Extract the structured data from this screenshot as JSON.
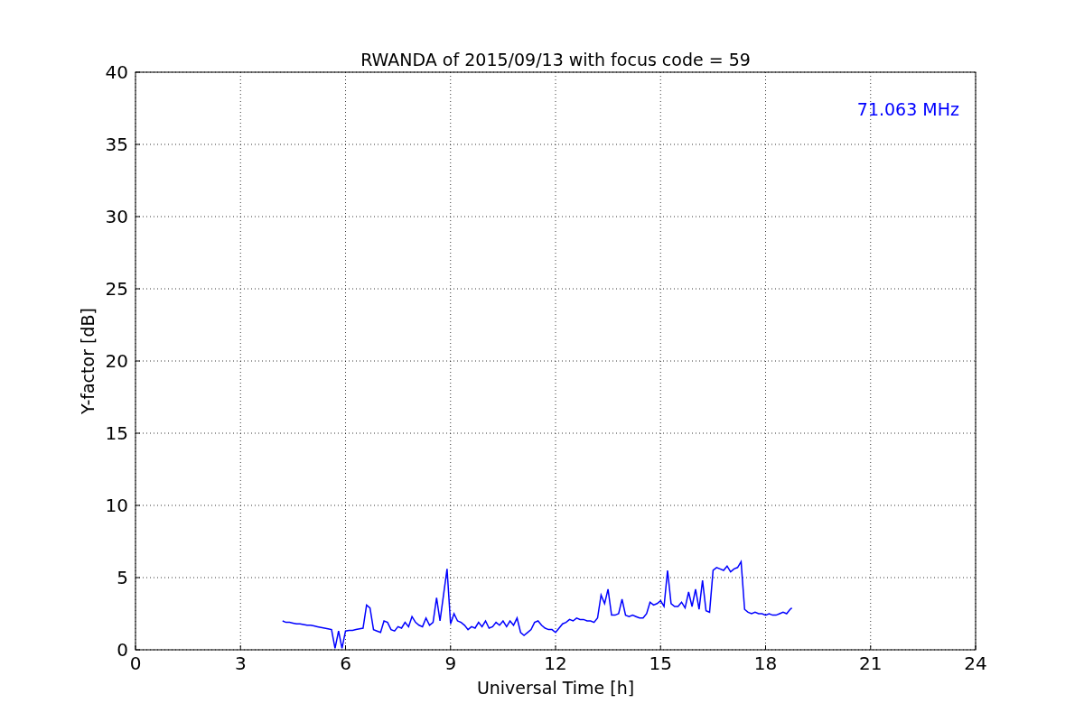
{
  "chart_data": {
    "type": "line",
    "title": "RWANDA of 2015/09/13 with focus code = 59",
    "xlabel": "Universal Time [h]",
    "ylabel": "Y-factor [dB]",
    "xlim": [
      0,
      24
    ],
    "ylim": [
      0,
      40
    ],
    "xticks": [
      0,
      3,
      6,
      9,
      12,
      15,
      18,
      21,
      24
    ],
    "yticks": [
      0,
      5,
      10,
      15,
      20,
      25,
      30,
      35,
      40
    ],
    "grid": true,
    "x": [
      4.2,
      4.3,
      4.4,
      4.5,
      4.6,
      4.7,
      4.8,
      4.9,
      5.0,
      5.1,
      5.2,
      5.3,
      5.4,
      5.5,
      5.6,
      5.7,
      5.8,
      5.9,
      6.0,
      6.1,
      6.2,
      6.3,
      6.4,
      6.5,
      6.6,
      6.7,
      6.8,
      6.9,
      7.0,
      7.1,
      7.2,
      7.3,
      7.4,
      7.5,
      7.6,
      7.7,
      7.8,
      7.9,
      8.0,
      8.1,
      8.2,
      8.3,
      8.4,
      8.5,
      8.6,
      8.7,
      8.8,
      8.9,
      9.0,
      9.1,
      9.2,
      9.3,
      9.4,
      9.5,
      9.6,
      9.7,
      9.8,
      9.9,
      10.0,
      10.1,
      10.2,
      10.3,
      10.4,
      10.5,
      10.6,
      10.7,
      10.8,
      10.9,
      11.0,
      11.1,
      11.2,
      11.3,
      11.4,
      11.5,
      11.6,
      11.7,
      11.8,
      11.9,
      12.0,
      12.1,
      12.2,
      12.3,
      12.4,
      12.5,
      12.6,
      12.7,
      12.8,
      12.9,
      13.0,
      13.1,
      13.2,
      13.3,
      13.4,
      13.5,
      13.6,
      13.7,
      13.8,
      13.9,
      14.0,
      14.1,
      14.2,
      14.3,
      14.4,
      14.5,
      14.6,
      14.7,
      14.8,
      14.9,
      15.0,
      15.1,
      15.2,
      15.3,
      15.4,
      15.5,
      15.6,
      15.7,
      15.8,
      15.9,
      16.0,
      16.1,
      16.2,
      16.3,
      16.4,
      16.5,
      16.6,
      16.7,
      16.8,
      16.9,
      17.0,
      17.1,
      17.2,
      17.3,
      17.4,
      17.5,
      17.6,
      17.7,
      17.8,
      17.9,
      18.0,
      18.1,
      18.2,
      18.3,
      18.4,
      18.5,
      18.6,
      18.7,
      18.75
    ],
    "series": [
      {
        "name": "71.063 MHz",
        "color": "#0000ff",
        "values": [
          2.0,
          1.9,
          1.9,
          1.85,
          1.8,
          1.8,
          1.75,
          1.7,
          1.7,
          1.65,
          1.6,
          1.55,
          1.5,
          1.45,
          1.4,
          0.1,
          1.3,
          0.1,
          1.3,
          1.35,
          1.35,
          1.4,
          1.45,
          1.5,
          3.1,
          2.9,
          1.4,
          1.3,
          1.2,
          2.0,
          1.9,
          1.4,
          1.3,
          1.6,
          1.5,
          1.9,
          1.6,
          2.3,
          1.9,
          1.7,
          1.6,
          2.2,
          1.7,
          1.9,
          3.6,
          2.0,
          3.8,
          5.6,
          1.8,
          2.5,
          2.0,
          1.9,
          1.7,
          1.4,
          1.6,
          1.5,
          1.9,
          1.6,
          2.0,
          1.5,
          1.6,
          1.9,
          1.7,
          2.0,
          1.6,
          2.0,
          1.7,
          2.2,
          1.2,
          1.0,
          1.2,
          1.4,
          1.9,
          2.0,
          1.7,
          1.5,
          1.4,
          1.4,
          1.2,
          1.5,
          1.8,
          1.9,
          2.1,
          2.0,
          2.2,
          2.1,
          2.1,
          2.0,
          2.0,
          1.9,
          2.2,
          3.8,
          3.2,
          4.2,
          2.4,
          2.4,
          2.5,
          3.5,
          2.4,
          2.3,
          2.4,
          2.3,
          2.2,
          2.2,
          2.5,
          3.3,
          3.1,
          3.2,
          3.4,
          3.0,
          5.5,
          3.2,
          3.0,
          3.0,
          3.3,
          2.9,
          4.0,
          3.0,
          4.2,
          2.8,
          4.8,
          2.7,
          2.6,
          5.5,
          5.7,
          5.6,
          5.5,
          5.8,
          5.4,
          5.6,
          5.7,
          6.1,
          2.8,
          2.6,
          2.5,
          2.6,
          2.5,
          2.5,
          2.4,
          2.5,
          2.4,
          2.4,
          2.5,
          2.6,
          2.5,
          2.8,
          2.9
        ]
      }
    ]
  }
}
